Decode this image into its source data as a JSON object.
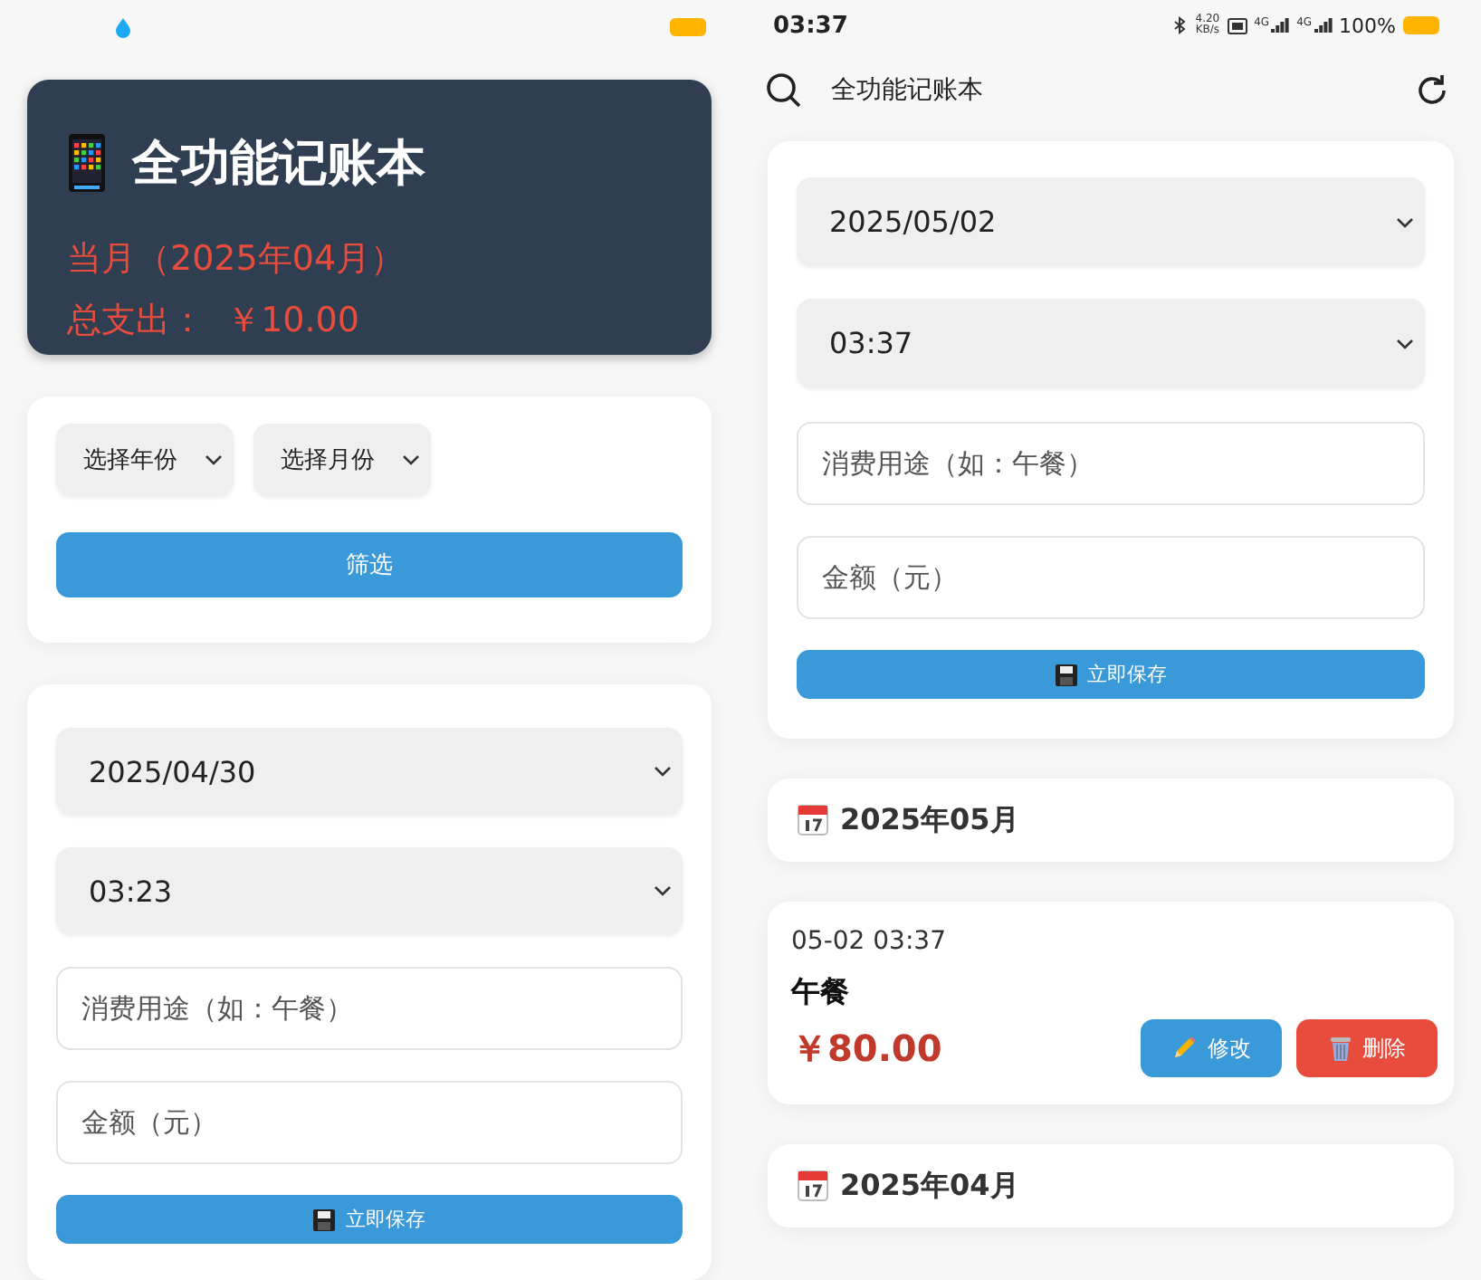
{
  "left_screen": {
    "summary": {
      "title": "全功能记账本",
      "month_label": "当月（2025年04月）",
      "total_label": "总支出：  ￥10.00"
    },
    "filter": {
      "year_select": "选择年份",
      "month_select": "选择月份",
      "filter_button": "筛选"
    },
    "entry_form": {
      "date": "2025/04/30",
      "time": "03:23",
      "purpose_placeholder": "消费用途（如：午餐）",
      "amount_placeholder": "金额（元）",
      "save_button": "立即保存"
    }
  },
  "right_screen": {
    "status_bar": {
      "time": "03:37",
      "net_speed": "4.20",
      "net_unit": "KB/s",
      "sim_1": "4G",
      "sim_2": "4G",
      "battery": "100%"
    },
    "app_bar": {
      "title": "全功能记账本"
    },
    "entry_form": {
      "date": "2025/05/02",
      "time": "03:37",
      "purpose_placeholder": "消费用途（如：午餐）",
      "amount_placeholder": "金额（元）",
      "save_button": "立即保存"
    },
    "groups": [
      {
        "month": "2025年05月",
        "records": [
          {
            "datetime": "05-02 03:37",
            "purpose": "午餐",
            "amount": "￥80.00",
            "edit_button": "修改",
            "delete_button": "删除"
          }
        ]
      },
      {
        "month": "2025年04月"
      }
    ]
  }
}
